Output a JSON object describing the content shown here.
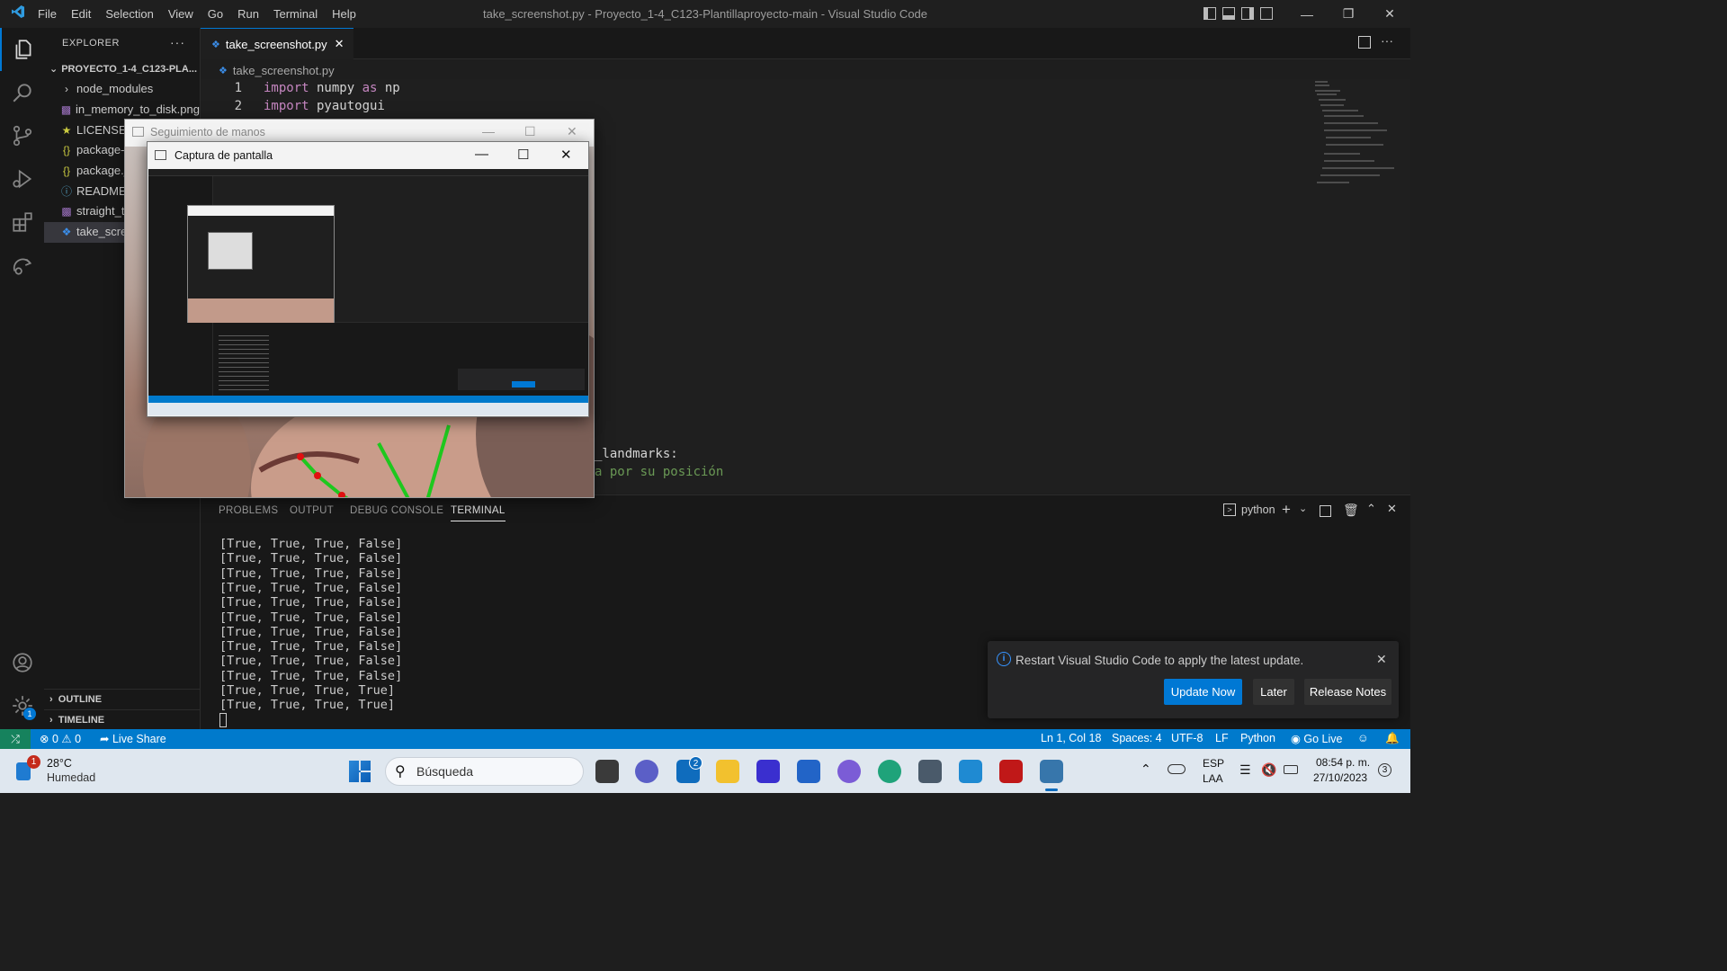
{
  "window": {
    "title": "take_screenshot.py - Proyecto_1-4_C123-Plantillaproyecto-main - Visual Studio Code",
    "menu": [
      "File",
      "Edit",
      "Selection",
      "View",
      "Go",
      "Run",
      "Terminal",
      "Help"
    ]
  },
  "activity_bar": {
    "items": [
      "explorer-icon",
      "search-icon",
      "source-control-icon",
      "run-debug-icon",
      "extensions-icon",
      "remote-explorer-icon"
    ],
    "bottom": [
      "accounts-icon",
      "manage-gear-icon"
    ],
    "manage_badge": "1"
  },
  "sidebar": {
    "header": "EXPLORER",
    "folder": "PROYECTO_1-4_C123-PLA...",
    "files": [
      {
        "name": "node_modules",
        "icon": "chevron-right-icon"
      },
      {
        "name": "in_memory_to_disk.png",
        "icon": "image-icon"
      },
      {
        "name": "LICENSE",
        "icon": "license-icon"
      },
      {
        "name": "package-",
        "icon": "json-icon"
      },
      {
        "name": "package.j",
        "icon": "json-icon"
      },
      {
        "name": "README.",
        "icon": "info-icon"
      },
      {
        "name": "straight_t",
        "icon": "image-icon"
      },
      {
        "name": "take_scre",
        "icon": "python-icon"
      }
    ],
    "outline": "OUTLINE",
    "timeline": "TIMELINE"
  },
  "editor": {
    "tab": "take_screenshot.py",
    "breadcrumb": "take_screenshot.py",
    "lines": [
      {
        "num": "1",
        "kw": "import",
        "rest": " numpy ",
        "kw2": "as",
        "rest2": " np"
      },
      {
        "num": "2",
        "kw": "import",
        "rest": " pyautogui",
        "kw2": "",
        "rest2": ""
      }
    ],
    "visible_fragment_1": "_landmarks:",
    "visible_fragment_2": "a por su posición"
  },
  "panel": {
    "tabs": [
      "PROBLEMS",
      "OUTPUT",
      "DEBUG CONSOLE",
      "TERMINAL"
    ],
    "active_tab": "TERMINAL",
    "terminal_name": "python",
    "output": [
      "[True, True, True, False]",
      "[True, True, True, False]",
      "[True, True, True, False]",
      "[True, True, True, False]",
      "[True, True, True, False]",
      "[True, True, True, False]",
      "[True, True, True, False]",
      "[True, True, True, False]",
      "[True, True, True, False]",
      "[True, True, True, False]",
      "[True, True, True, True]",
      "[True, True, True, True]"
    ]
  },
  "notification": {
    "message": "Restart Visual Studio Code to apply the latest update.",
    "buttons": [
      "Update Now",
      "Later",
      "Release Notes"
    ]
  },
  "status_bar": {
    "errors": "0",
    "warnings": "0",
    "live_share": "Live Share",
    "position": "Ln 1, Col 18",
    "spaces": "Spaces: 4",
    "encoding": "UTF-8",
    "eol": "LF",
    "language": "Python",
    "go_live": "Go Live"
  },
  "overlay_windows": {
    "hands_title": "Seguimiento de manos",
    "capture_title": "Captura de pantalla"
  },
  "taskbar": {
    "weather_temp": "28°C",
    "weather_desc": "Humedad",
    "weather_badge": "1",
    "search_placeholder": "Búsqueda",
    "mail_badge": "2",
    "lang_1": "ESP",
    "lang_2": "LAA",
    "time": "08:54 p. m.",
    "date": "27/10/2023",
    "notif_count": "3"
  },
  "colors": {
    "accent": "#0078d4",
    "statusbar": "#007acc",
    "keyword": "#c586c0",
    "comment": "#6a9955",
    "landmark_line": "#1ec81e",
    "landmark_point": "#e01010"
  }
}
